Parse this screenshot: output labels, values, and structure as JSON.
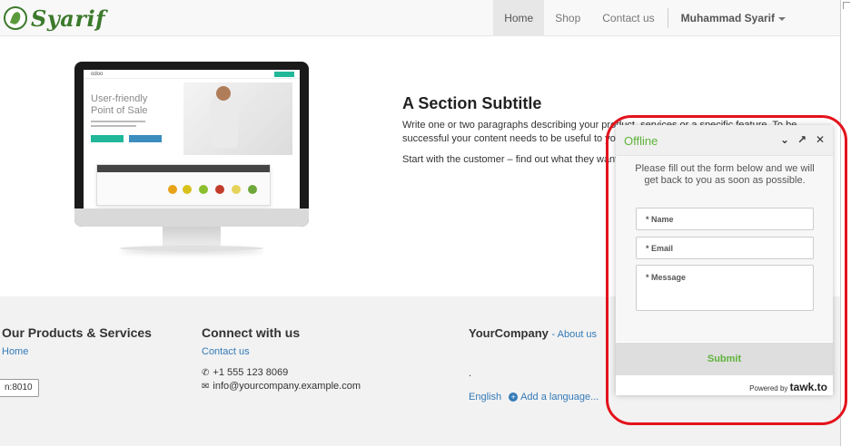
{
  "navbar": {
    "brand": "Syarif",
    "items": [
      {
        "label": "Home",
        "active": true
      },
      {
        "label": "Shop",
        "active": false
      },
      {
        "label": "Contact us",
        "active": false
      }
    ],
    "user": "Muhammad Syarif"
  },
  "monitor_screen": {
    "logo": "odoo",
    "headline_line1": "User-friendly",
    "headline_line2": "Point of Sale"
  },
  "section": {
    "title": "A Section Subtitle",
    "p1_line1": "Write one or two paragraphs describing your product, services or a specific feature. To be",
    "p1_line2": "successful your content needs to be useful to your readers.",
    "p2": "Start with the customer – find out what they want and give it to them."
  },
  "footer": {
    "products_heading": "Our Products & Services",
    "products_link": "Home",
    "connect_heading": "Connect with us",
    "contact_link": "Contact us",
    "phone": "+1 555 123 8069",
    "email": "info@yourcompany.example.com",
    "company": "YourCompany",
    "about_link": "- About us",
    "dot": ".",
    "lang": "English",
    "add_lang": "Add a language...",
    "port": "n:8010"
  },
  "chat": {
    "status": "Offline",
    "message": "Please fill out the form below and we will get back to you as soon as possible.",
    "name_placeholder": "* Name",
    "email_placeholder": "* Email",
    "message_placeholder": "* Message",
    "submit": "Submit",
    "powered_by": "Powered by",
    "brand": "tawk.to"
  },
  "colors": {
    "brand_green": "#3c7a2c",
    "chat_green": "#5fb33a",
    "link_blue": "#337ab7",
    "highlight_red": "#e4121c"
  }
}
